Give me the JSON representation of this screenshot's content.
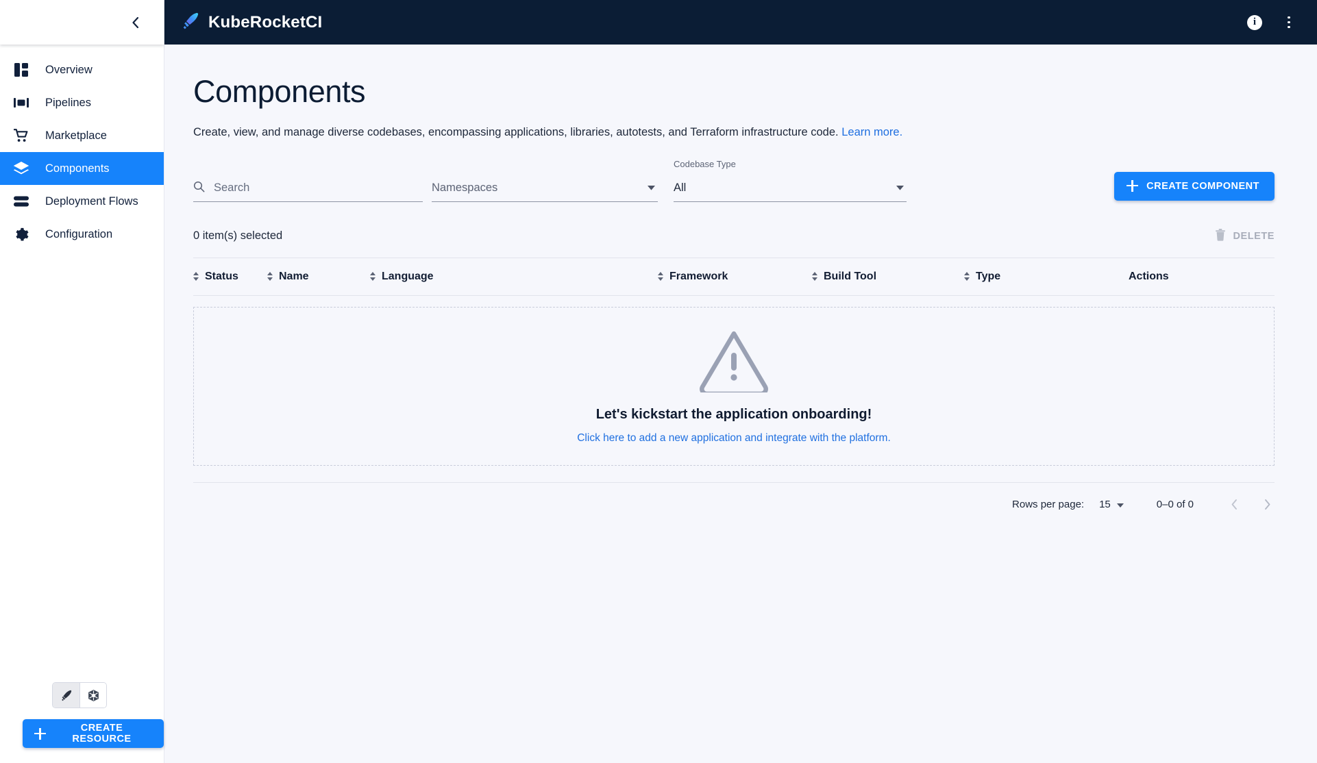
{
  "header": {
    "brand": "KubeRocketCI",
    "logo_icon": "rocket-pen-icon",
    "info_icon": "info-icon",
    "info_glyph": "i",
    "overflow_icon": "more-vertical-icon",
    "background": "#0b1d35"
  },
  "sidebar": {
    "collapse_icon": "chevron-left-icon",
    "items": [
      {
        "label": "Overview",
        "icon": "dashboard-icon",
        "active": false
      },
      {
        "label": "Pipelines",
        "icon": "pipelines-icon",
        "active": false
      },
      {
        "label": "Marketplace",
        "icon": "shopping-cart-icon",
        "active": false
      },
      {
        "label": "Components",
        "icon": "layers-icon",
        "active": true
      },
      {
        "label": "Deployment Flows",
        "icon": "stacked-bars-icon",
        "active": false
      },
      {
        "label": "Configuration",
        "icon": "gear-icon",
        "active": false
      }
    ],
    "view_toggle": [
      {
        "icon": "kuberocket-pen-icon",
        "selected": true
      },
      {
        "icon": "kubernetes-helm-icon",
        "selected": false
      }
    ],
    "create_resource_label": "CREATE RESOURCE",
    "active_color": "#1683fb"
  },
  "page": {
    "title": "Components",
    "description": "Create, view, and manage diverse codebases, encompassing applications, libraries, autotests, and Terraform infrastructure code.",
    "learn_more": "Learn more."
  },
  "filters": {
    "search_placeholder": "Search",
    "search_value": "",
    "search_icon": "search-icon",
    "namespaces_placeholder": "Namespaces",
    "namespaces_value": "",
    "codebase_type_label": "Codebase Type",
    "codebase_type_value": "All",
    "dropdown_icon": "chevron-down-icon"
  },
  "toolbar": {
    "create_component_label": "CREATE COMPONENT",
    "plus_icon": "plus-icon",
    "selected_text": "0 item(s) selected",
    "delete_label": "DELETE",
    "delete_icon": "trash-icon",
    "delete_disabled": true
  },
  "table": {
    "columns": [
      {
        "label": "Status",
        "sortable": true
      },
      {
        "label": "Name",
        "sortable": true
      },
      {
        "label": "Language",
        "sortable": true
      },
      {
        "label": "Framework",
        "sortable": true
      },
      {
        "label": "Build Tool",
        "sortable": true
      },
      {
        "label": "Type",
        "sortable": true
      },
      {
        "label": "Actions",
        "sortable": false
      }
    ],
    "rows": [],
    "empty_state": {
      "icon": "warning-triangle-icon",
      "title": "Let's kickstart the application onboarding!",
      "link": "Click here to add a new application and integrate with the platform."
    }
  },
  "pagination": {
    "rows_per_page_label": "Rows per page:",
    "rows_per_page_value": "15",
    "range": "0–0 of 0",
    "prev_icon": "chevron-left-icon",
    "next_icon": "chevron-right-icon",
    "prev_disabled": true,
    "next_disabled": true
  }
}
